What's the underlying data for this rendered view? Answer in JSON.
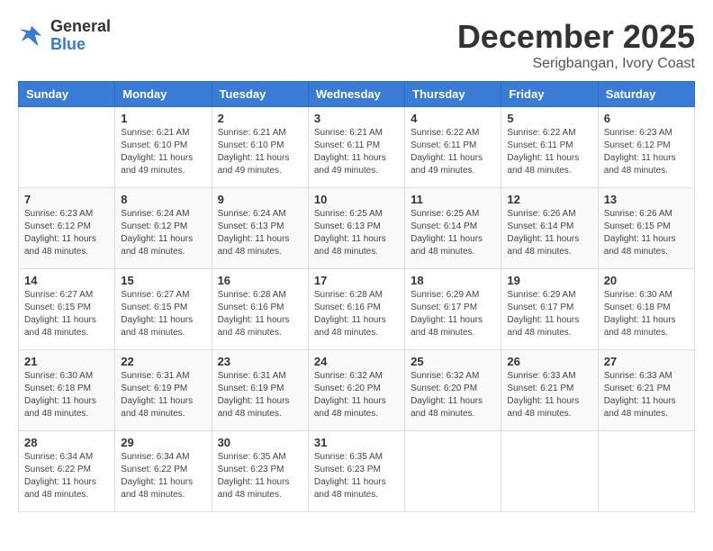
{
  "logo": {
    "general": "General",
    "blue": "Blue"
  },
  "title": "December 2025",
  "location": "Serigbangan, Ivory Coast",
  "weekdays": [
    "Sunday",
    "Monday",
    "Tuesday",
    "Wednesday",
    "Thursday",
    "Friday",
    "Saturday"
  ],
  "weeks": [
    [
      {
        "day": "",
        "info": ""
      },
      {
        "day": "1",
        "info": "Sunrise: 6:21 AM\nSunset: 6:10 PM\nDaylight: 11 hours\nand 49 minutes."
      },
      {
        "day": "2",
        "info": "Sunrise: 6:21 AM\nSunset: 6:10 PM\nDaylight: 11 hours\nand 49 minutes."
      },
      {
        "day": "3",
        "info": "Sunrise: 6:21 AM\nSunset: 6:11 PM\nDaylight: 11 hours\nand 49 minutes."
      },
      {
        "day": "4",
        "info": "Sunrise: 6:22 AM\nSunset: 6:11 PM\nDaylight: 11 hours\nand 49 minutes."
      },
      {
        "day": "5",
        "info": "Sunrise: 6:22 AM\nSunset: 6:11 PM\nDaylight: 11 hours\nand 48 minutes."
      },
      {
        "day": "6",
        "info": "Sunrise: 6:23 AM\nSunset: 6:12 PM\nDaylight: 11 hours\nand 48 minutes."
      }
    ],
    [
      {
        "day": "7",
        "info": "Sunrise: 6:23 AM\nSunset: 6:12 PM\nDaylight: 11 hours\nand 48 minutes."
      },
      {
        "day": "8",
        "info": "Sunrise: 6:24 AM\nSunset: 6:12 PM\nDaylight: 11 hours\nand 48 minutes."
      },
      {
        "day": "9",
        "info": "Sunrise: 6:24 AM\nSunset: 6:13 PM\nDaylight: 11 hours\nand 48 minutes."
      },
      {
        "day": "10",
        "info": "Sunrise: 6:25 AM\nSunset: 6:13 PM\nDaylight: 11 hours\nand 48 minutes."
      },
      {
        "day": "11",
        "info": "Sunrise: 6:25 AM\nSunset: 6:14 PM\nDaylight: 11 hours\nand 48 minutes."
      },
      {
        "day": "12",
        "info": "Sunrise: 6:26 AM\nSunset: 6:14 PM\nDaylight: 11 hours\nand 48 minutes."
      },
      {
        "day": "13",
        "info": "Sunrise: 6:26 AM\nSunset: 6:15 PM\nDaylight: 11 hours\nand 48 minutes."
      }
    ],
    [
      {
        "day": "14",
        "info": "Sunrise: 6:27 AM\nSunset: 6:15 PM\nDaylight: 11 hours\nand 48 minutes."
      },
      {
        "day": "15",
        "info": "Sunrise: 6:27 AM\nSunset: 6:15 PM\nDaylight: 11 hours\nand 48 minutes."
      },
      {
        "day": "16",
        "info": "Sunrise: 6:28 AM\nSunset: 6:16 PM\nDaylight: 11 hours\nand 48 minutes."
      },
      {
        "day": "17",
        "info": "Sunrise: 6:28 AM\nSunset: 6:16 PM\nDaylight: 11 hours\nand 48 minutes."
      },
      {
        "day": "18",
        "info": "Sunrise: 6:29 AM\nSunset: 6:17 PM\nDaylight: 11 hours\nand 48 minutes."
      },
      {
        "day": "19",
        "info": "Sunrise: 6:29 AM\nSunset: 6:17 PM\nDaylight: 11 hours\nand 48 minutes."
      },
      {
        "day": "20",
        "info": "Sunrise: 6:30 AM\nSunset: 6:18 PM\nDaylight: 11 hours\nand 48 minutes."
      }
    ],
    [
      {
        "day": "21",
        "info": "Sunrise: 6:30 AM\nSunset: 6:18 PM\nDaylight: 11 hours\nand 48 minutes."
      },
      {
        "day": "22",
        "info": "Sunrise: 6:31 AM\nSunset: 6:19 PM\nDaylight: 11 hours\nand 48 minutes."
      },
      {
        "day": "23",
        "info": "Sunrise: 6:31 AM\nSunset: 6:19 PM\nDaylight: 11 hours\nand 48 minutes."
      },
      {
        "day": "24",
        "info": "Sunrise: 6:32 AM\nSunset: 6:20 PM\nDaylight: 11 hours\nand 48 minutes."
      },
      {
        "day": "25",
        "info": "Sunrise: 6:32 AM\nSunset: 6:20 PM\nDaylight: 11 hours\nand 48 minutes."
      },
      {
        "day": "26",
        "info": "Sunrise: 6:33 AM\nSunset: 6:21 PM\nDaylight: 11 hours\nand 48 minutes."
      },
      {
        "day": "27",
        "info": "Sunrise: 6:33 AM\nSunset: 6:21 PM\nDaylight: 11 hours\nand 48 minutes."
      }
    ],
    [
      {
        "day": "28",
        "info": "Sunrise: 6:34 AM\nSunset: 6:22 PM\nDaylight: 11 hours\nand 48 minutes."
      },
      {
        "day": "29",
        "info": "Sunrise: 6:34 AM\nSunset: 6:22 PM\nDaylight: 11 hours\nand 48 minutes."
      },
      {
        "day": "30",
        "info": "Sunrise: 6:35 AM\nSunset: 6:23 PM\nDaylight: 11 hours\nand 48 minutes."
      },
      {
        "day": "31",
        "info": "Sunrise: 6:35 AM\nSunset: 6:23 PM\nDaylight: 11 hours\nand 48 minutes."
      },
      {
        "day": "",
        "info": ""
      },
      {
        "day": "",
        "info": ""
      },
      {
        "day": "",
        "info": ""
      }
    ]
  ]
}
